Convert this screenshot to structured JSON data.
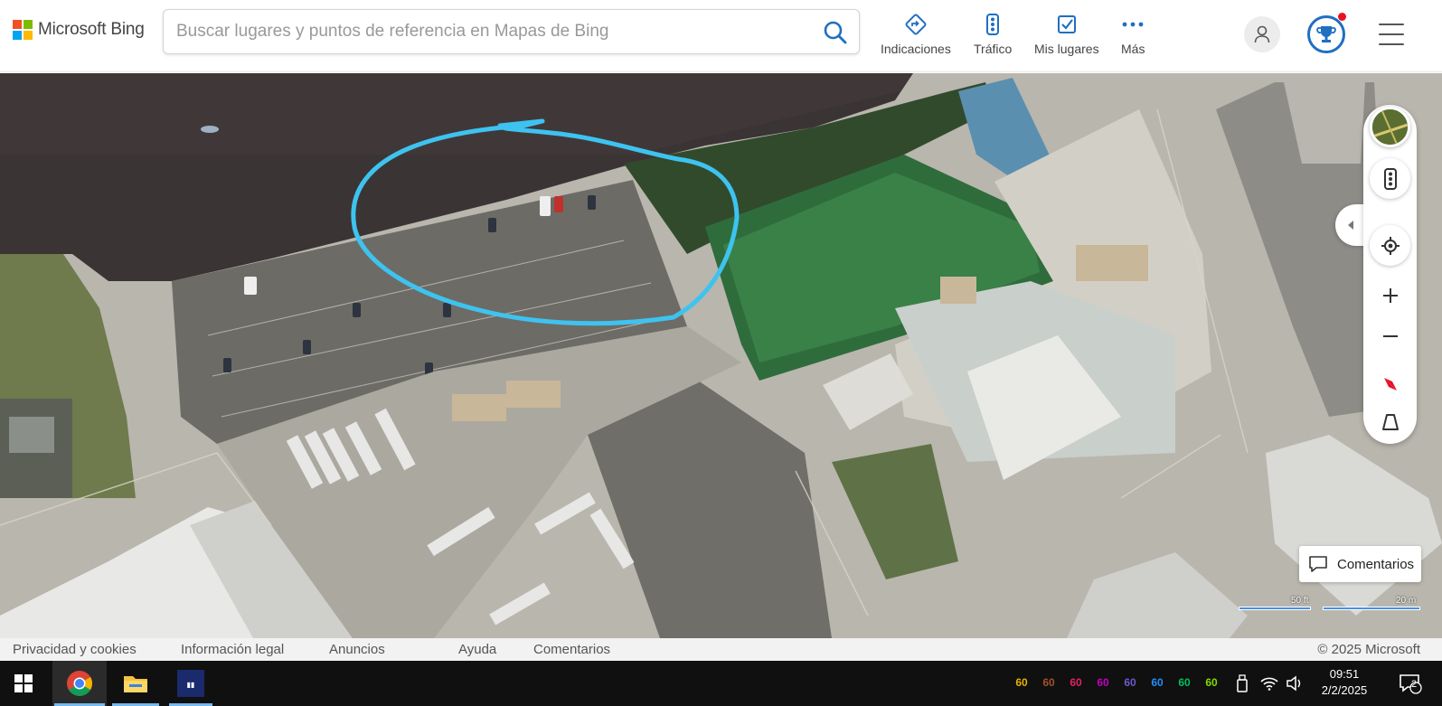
{
  "brand": {
    "name": "Microsoft Bing"
  },
  "search": {
    "placeholder": "Buscar lugares y puntos de referencia en Mapas de Bing",
    "value": ""
  },
  "nav": [
    {
      "label": "Indicaciones",
      "icon": "directions-icon"
    },
    {
      "label": "Tráfico",
      "icon": "traffic-icon"
    },
    {
      "label": "Mis lugares",
      "icon": "my-places-icon"
    },
    {
      "label": "Más",
      "icon": "more-icon"
    }
  ],
  "map": {
    "view": "aerial",
    "annotation_color": "#3ec3f0",
    "feedback_label": "Comentarios",
    "scale": {
      "imperial": "50 ft",
      "metric": "20 m"
    }
  },
  "footer": {
    "links": [
      "Privacidad y cookies",
      "Información legal",
      "Anuncios",
      "Ayuda",
      "Comentarios"
    ],
    "copyright": "© 2025 Microsoft"
  },
  "taskbar": {
    "tray_numbers": [
      {
        "value": "60",
        "color": "#e8b200"
      },
      {
        "value": "60",
        "color": "#a0522d"
      },
      {
        "value": "60",
        "color": "#e0245e"
      },
      {
        "value": "60",
        "color": "#c000c0"
      },
      {
        "value": "60",
        "color": "#6a5acd"
      },
      {
        "value": "60",
        "color": "#1e90ff"
      },
      {
        "value": "60",
        "color": "#00c060"
      },
      {
        "value": "60",
        "color": "#7fdc00"
      }
    ],
    "time": "09:51",
    "date": "2/2/2025",
    "notifications": "2"
  }
}
